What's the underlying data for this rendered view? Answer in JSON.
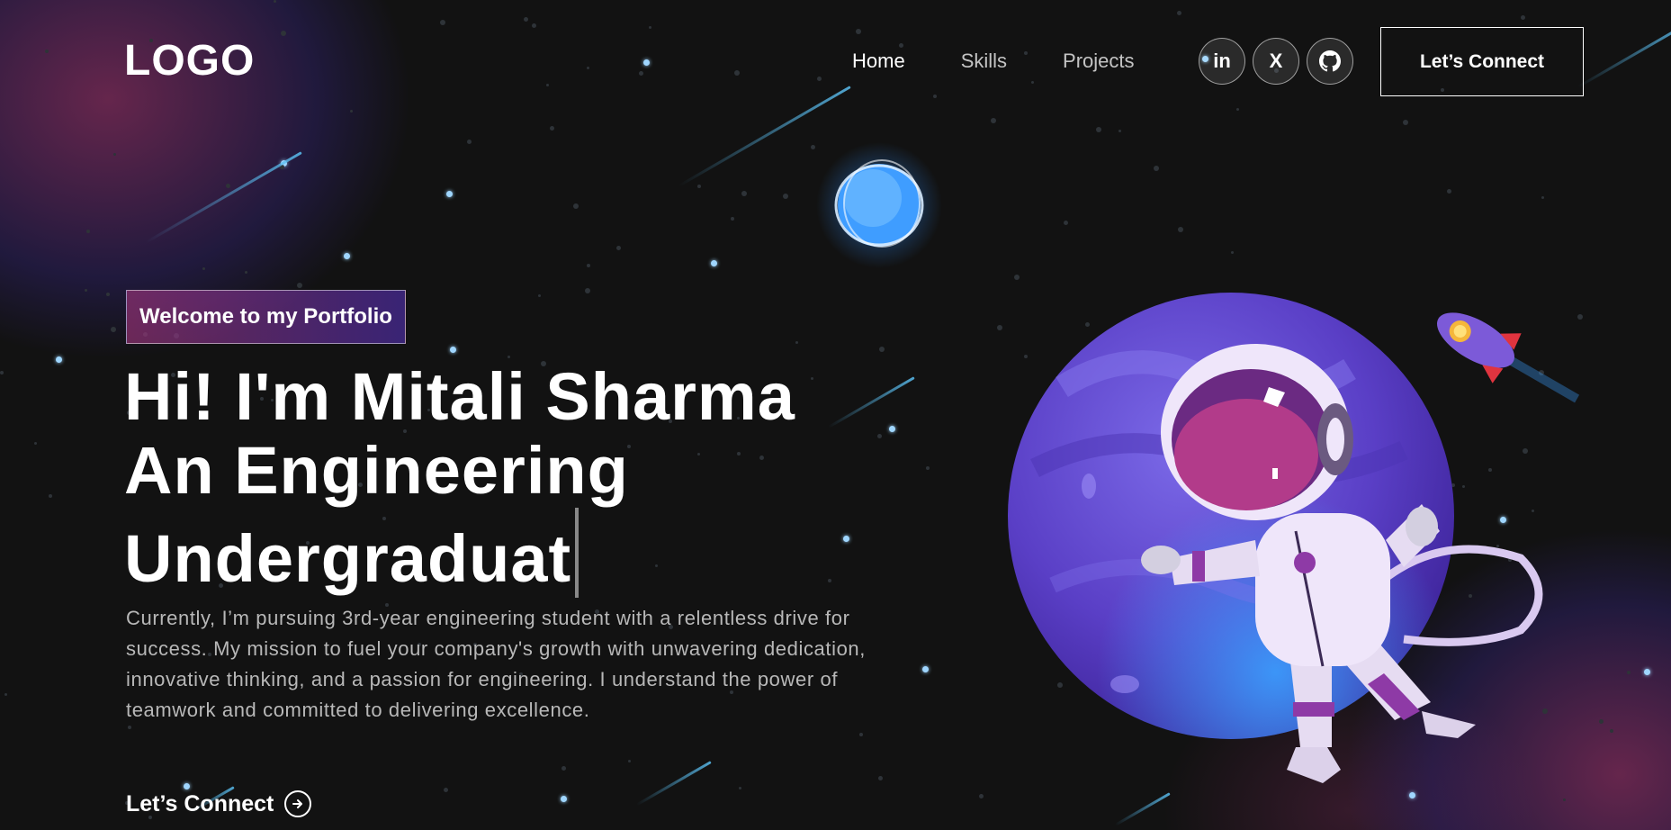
{
  "nav": {
    "logo": "LOGO",
    "links": [
      {
        "label": "Home",
        "active": true
      },
      {
        "label": "Skills",
        "active": false
      },
      {
        "label": "Projects",
        "active": false
      }
    ],
    "socials": [
      {
        "icon": "linkedin-icon",
        "glyph": "in"
      },
      {
        "icon": "x-twitter-icon",
        "glyph": "X"
      },
      {
        "icon": "github-icon",
        "glyph": ""
      }
    ],
    "connect_label": "Let’s Connect"
  },
  "hero": {
    "tagline": "Welcome to my Portfolio",
    "headline_line1": "Hi! I'm Mitali Sharma",
    "headline_line2": "An Engineering",
    "headline_line3": "Undergraduat",
    "description": "Currently, I’m pursuing 3rd-year engineering student with a relentless drive for success. My mission to fuel your company's growth with unwavering dedication, innovative thinking, and a passion for engineering. I understand the power of teamwork and committed to delivering excellence.",
    "cta_label": "Let’s Connect"
  },
  "colors": {
    "background": "#121212",
    "accent_pink": "#AA367C",
    "accent_purple": "#4A2FBD",
    "planet": "#6A4FD8",
    "star": "#9FD6FF"
  }
}
